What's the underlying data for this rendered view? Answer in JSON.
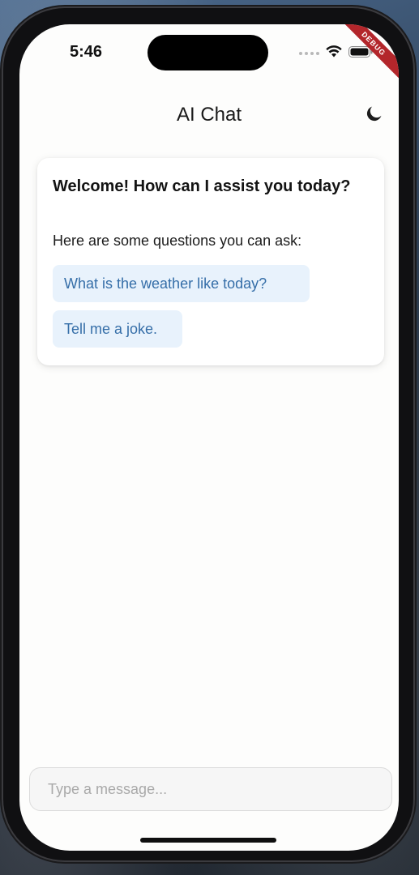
{
  "status_bar": {
    "time": "5:46",
    "debug_banner": "DEBUG",
    "icons": [
      "cellular-signal-icon",
      "wifi-icon",
      "battery-icon"
    ]
  },
  "app_bar": {
    "title": "AI Chat",
    "theme_toggle_icon": "moon-icon"
  },
  "welcome_card": {
    "title": "Welcome! How can I assist you today?",
    "subtitle": "Here are some questions you can ask:",
    "suggestions": [
      {
        "label": "What is the weather like today?"
      },
      {
        "label": "Tell me a joke."
      }
    ]
  },
  "composer": {
    "placeholder": "Type a message...",
    "value": ""
  },
  "colors": {
    "accent_text": "#356ea8",
    "suggestion_bg": "#e8f2fc",
    "debug_ribbon": "#b3262b"
  }
}
